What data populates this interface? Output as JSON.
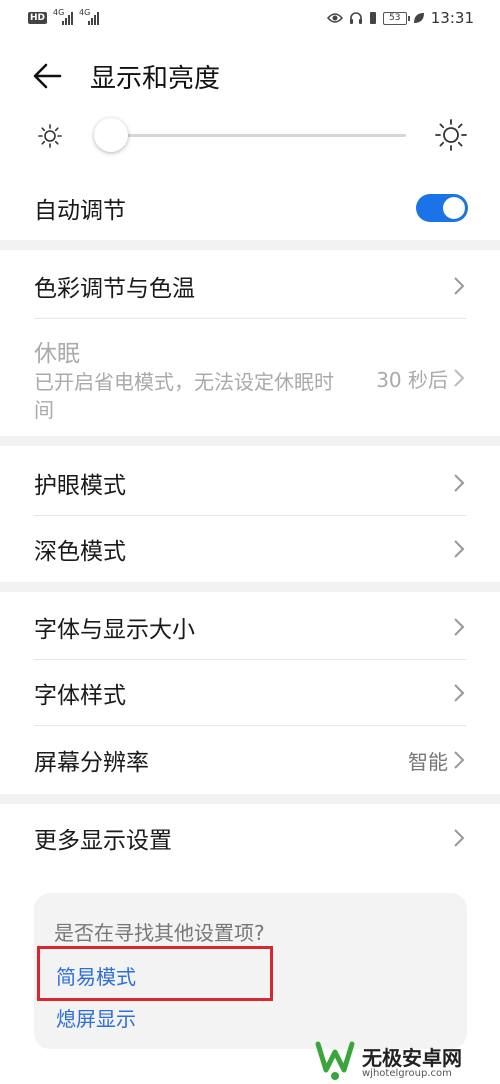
{
  "status_bar": {
    "hd": "HD",
    "net1": "4G",
    "net2": "4G",
    "battery": "53",
    "time": "13:31"
  },
  "header": {
    "title": "显示和亮度"
  },
  "brightness": {
    "level": 0.03
  },
  "auto_adjust": {
    "label": "自动调节",
    "enabled": true,
    "accent_color": "#1a73e8"
  },
  "section1": {
    "color_temp_label": "色彩调节与色温",
    "sleep_label": "休眠",
    "sleep_desc": "已开启省电模式，无法设定休眠时间",
    "sleep_value": "30 秒后"
  },
  "section2": {
    "eye_label": "护眼模式",
    "dark_label": "深色模式"
  },
  "section3": {
    "font_size_label": "字体与显示大小",
    "font_style_label": "字体样式",
    "resolution_label": "屏幕分辨率",
    "resolution_value": "智能"
  },
  "section4": {
    "more_label": "更多显示设置"
  },
  "suggestions": {
    "question": "是否在寻找其他设置项?",
    "link1": "简易模式",
    "link2": "熄屏显示"
  },
  "watermark": {
    "name": "无极安卓网",
    "url": "wjhotelgroup.com"
  }
}
